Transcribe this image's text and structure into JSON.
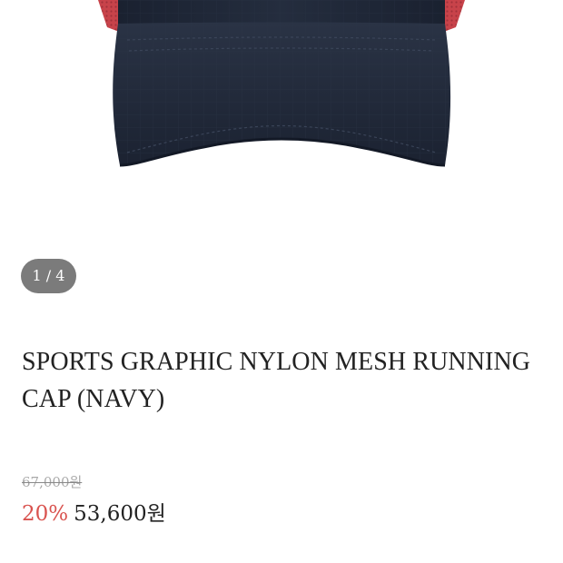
{
  "gallery": {
    "counter": "1 / 4",
    "image_alt": "navy running cap"
  },
  "product": {
    "title": "SPORTS GRAPHIC NYLON MESH RUNNING CAP (NAVY)",
    "original_price": "67,000원",
    "discount": "20%",
    "sale_price": "53,600원"
  },
  "colors": {
    "cap_navy": "#1e2636",
    "mesh_red": "#c8434a",
    "counter_bg": "#7b7b7b",
    "discount": "#d9534f",
    "title": "#222222",
    "strike": "#a9a9a9"
  }
}
